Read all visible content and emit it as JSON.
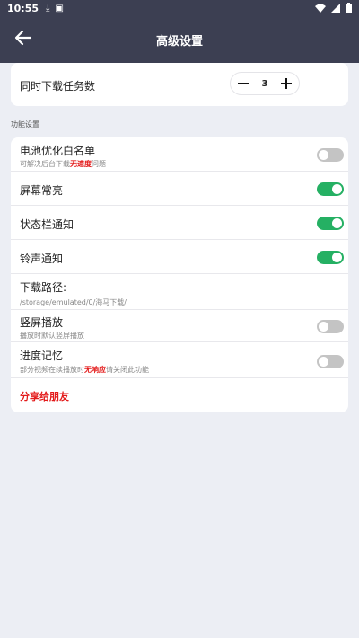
{
  "statusbar": {
    "time": "10:55"
  },
  "header": {
    "title": "高级设置"
  },
  "downloads": {
    "label": "同时下载任务数",
    "value": "3"
  },
  "section": {
    "title": "功能设置"
  },
  "settings": {
    "battery": {
      "title": "电池优化白名单",
      "sub_pre": "可解决后台下载",
      "sub_hl": "无速度",
      "sub_post": "问题",
      "enabled": false
    },
    "screen_on": {
      "title": "屏幕常亮",
      "enabled": true
    },
    "status_notify": {
      "title": "状态栏通知",
      "enabled": true
    },
    "ring_notify": {
      "title": "铃声通知",
      "enabled": true
    },
    "download_path": {
      "title": "下载路径:",
      "value": "/storage/emulated/0/海马下载/"
    },
    "portrait": {
      "title": "竖屏播放",
      "sub": "播放时默认竖屏播放",
      "enabled": false
    },
    "progress_memory": {
      "title": "进度记忆",
      "sub_pre": "部分视频在续播放时",
      "sub_hl": "无响应",
      "sub_post": "请关闭此功能",
      "enabled": false
    }
  },
  "share": {
    "label": "分享给朋友"
  },
  "colors": {
    "appbar": "#3c3f52",
    "toggle_on": "#25b063",
    "toggle_off": "#c4c4c4",
    "accent_red": "#e31a1a"
  }
}
